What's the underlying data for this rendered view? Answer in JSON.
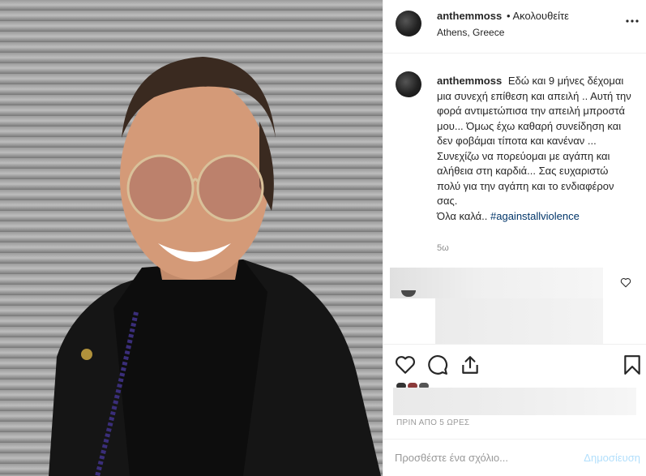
{
  "post": {
    "username": "anthemmoss",
    "follow_status": "• Ακολουθείτε",
    "location": "Athens, Greece",
    "caption_username": "anthemmoss",
    "caption_text": "Εδώ και 9 μήνες δέχομαι μια συνεχή επίθεση και απειλή .. Αυτή την φορά αντιμετώπισα την απειλή μπροστά μου... Όμως έχω καθαρή συνείδηση και δεν φοβάμαι τίποτα και κανέναν ... Συνεχίζω να πορεύομαι με αγάπη και αλήθεια στη καρδιά... Σας ευχαριστώ πολύ για την αγάπη και το ενδιαφέρον σας.",
    "caption_last_line": "Όλα καλά.. ",
    "hashtag": "#againstallviolence",
    "time_ago": "5ω",
    "timestamp": "ΠΡΙΝ ΑΠΟ 5 ΩΡΕΣ"
  },
  "comment_box": {
    "placeholder": "Προσθέστε ένα σχόλιο...",
    "post_label": "Δημοσίευση"
  },
  "icons": {
    "more": "more-options-icon",
    "like": "heart-icon",
    "comment": "speech-bubble-icon",
    "share": "share-icon",
    "save": "bookmark-icon"
  },
  "colors": {
    "text": "#262626",
    "muted": "#8e8e8e",
    "hashtag": "#003569",
    "post_button_disabled": "#b2dffc",
    "border": "#efefef"
  }
}
